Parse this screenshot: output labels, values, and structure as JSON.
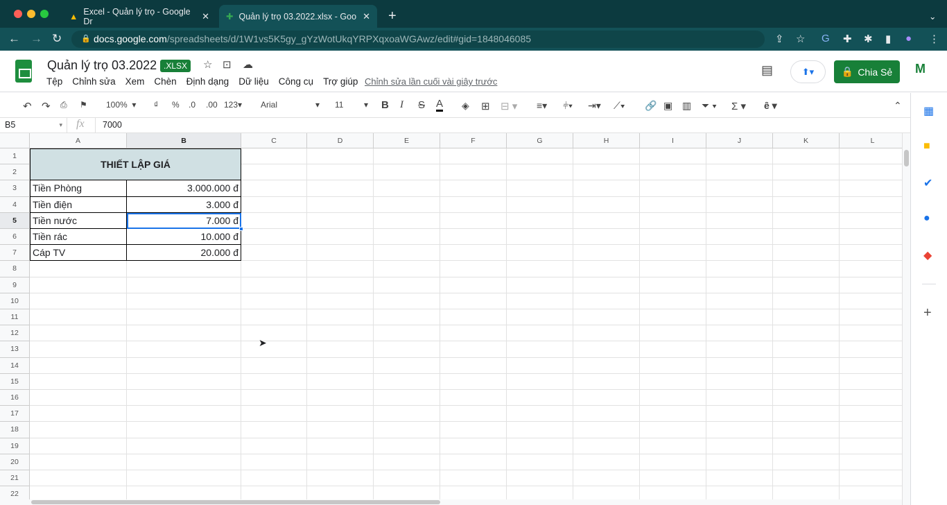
{
  "browser": {
    "tabs": [
      {
        "label": "Excel - Quản lý trọ - Google Dr",
        "icon": "google-drive-icon"
      },
      {
        "label": "Quản lý trọ 03.2022.xlsx - Goo",
        "icon": "sheets-icon"
      }
    ],
    "url_host": "docs.google.com",
    "url_path": "/spreadsheets/d/1W1vs5K5gy_gYzWotUkqYRPXqxoaWGAwz/edit#gid=1848046085"
  },
  "doc": {
    "title": "Quản lý trọ 03.2022",
    "badge": ".XLSX",
    "menu": [
      "Tệp",
      "Chỉnh sửa",
      "Xem",
      "Chèn",
      "Định dạng",
      "Dữ liệu",
      "Công cụ",
      "Trợ giúp"
    ],
    "last_edit": "Chỉnh sửa lần cuối vài giây trước",
    "share": "Chia Sẻ"
  },
  "toolbar": {
    "zoom": "100%",
    "currency": "₫",
    "percent": "%",
    "dec_dec": ".0",
    "dec_inc": ".00",
    "format": "123",
    "font": "Arial",
    "size": "11"
  },
  "formula": {
    "cell_ref": "B5",
    "value": "7000"
  },
  "columns": [
    "A",
    "B",
    "C",
    "D",
    "E",
    "F",
    "G",
    "H",
    "I",
    "J",
    "K",
    "L"
  ],
  "rows": 22,
  "sheet": {
    "header": "THIẾT LẬP GIÁ",
    "items": [
      {
        "label": "Tiền Phòng",
        "value": "3.000.000 đ"
      },
      {
        "label": "Tiền điện",
        "value": "3.000 đ"
      },
      {
        "label": "Tiền nước",
        "value": "7.000 đ"
      },
      {
        "label": "Tiền rác",
        "value": "10.000 đ"
      },
      {
        "label": "Cáp TV",
        "value": "20.000 đ"
      }
    ]
  },
  "colors": {
    "accent": "#188038",
    "header_fill": "#d0e0e3",
    "selection": "#1a73e8"
  }
}
